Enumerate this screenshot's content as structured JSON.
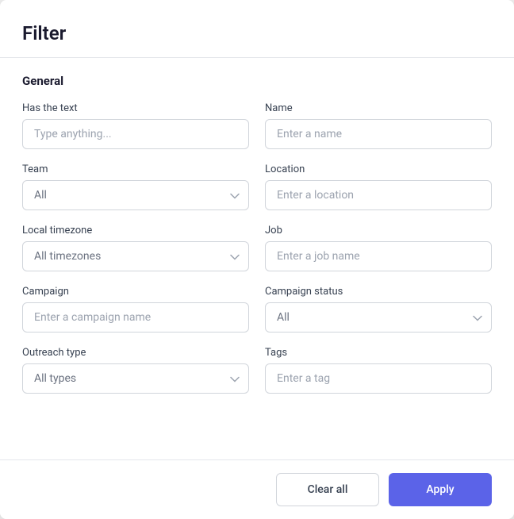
{
  "modal": {
    "title": "Filter",
    "section": {
      "title": "General"
    },
    "fields": {
      "has_the_text": {
        "label": "Has the text",
        "placeholder": "Type anything..."
      },
      "name": {
        "label": "Name",
        "placeholder": "Enter a name"
      },
      "team": {
        "label": "Team",
        "placeholder": "All"
      },
      "location": {
        "label": "Location",
        "placeholder": "Enter a location"
      },
      "local_timezone": {
        "label": "Local timezone",
        "placeholder": "All timezones"
      },
      "job": {
        "label": "Job",
        "placeholder": "Enter a job name"
      },
      "campaign": {
        "label": "Campaign",
        "placeholder": "Enter a campaign name"
      },
      "campaign_status": {
        "label": "Campaign status",
        "placeholder": "All"
      },
      "outreach_type": {
        "label": "Outreach type",
        "placeholder": "All types"
      },
      "tags": {
        "label": "Tags",
        "placeholder": "Enter a tag"
      }
    },
    "footer": {
      "clear_label": "Clear all",
      "apply_label": "Apply"
    }
  }
}
